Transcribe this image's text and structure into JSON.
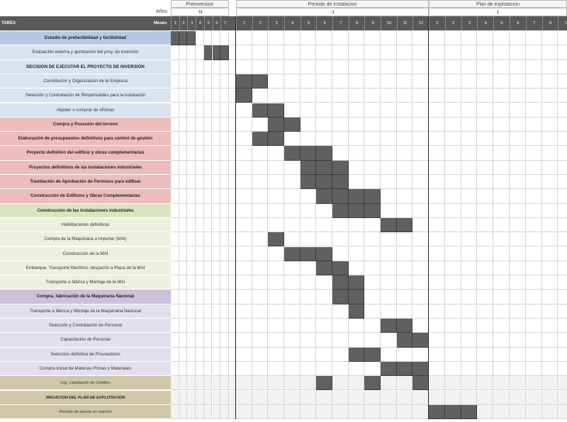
{
  "header": {
    "years_label": "Años",
    "months_label": "Meses",
    "task_label": "TAREA",
    "phases": [
      {
        "title": "Preinversion",
        "year": "-N"
      },
      {
        "title": "Periodo de instalacion",
        "year": "-1"
      },
      {
        "title": "Plan de explotacion",
        "year": "1"
      }
    ],
    "months": {
      "preinversion": [
        "1",
        "2",
        "3",
        "4",
        "5",
        "6",
        "7"
      ],
      "instalacion": [
        "1",
        "2",
        "3",
        "4",
        "5",
        "6",
        "7",
        "8",
        "9",
        "10",
        "11",
        "12"
      ],
      "explotacion": [
        "1",
        "2",
        "3",
        "4",
        "5",
        "6",
        "7",
        "8",
        "9"
      ]
    }
  },
  "colors": {
    "blue": "#dae3f0",
    "blue_strong": "#b5c9e4",
    "red": "#edbcbc",
    "red_strong": "#e6aaaa",
    "green": "#ebf1de",
    "green_strong": "#d8e6c0",
    "purple": "#e4dfec",
    "purple_strong": "#ccc0da",
    "olive": "#cfc7a6",
    "bar": "#606060"
  },
  "tasks": [
    {
      "label": "Estudio de prefactibilidad y factibilidad",
      "style": "bold",
      "color": "blue_strong",
      "bars": [
        [
          "pre",
          1,
          3
        ]
      ]
    },
    {
      "label": "Evaluación externa y aprobación del proy. de inversión",
      "style": "normal",
      "color": "blue",
      "bars": [
        [
          "pre",
          5,
          7
        ]
      ]
    },
    {
      "label": "DECISIÓN DE EJECUTAR EL PROYECTO DE INVERSIÓN",
      "style": "bold",
      "color": "blue",
      "bars": []
    },
    {
      "label": "Constitución y Organización de la Empresa",
      "style": "normal",
      "color": "blue",
      "bars": [
        [
          "ins",
          1,
          2
        ]
      ]
    },
    {
      "label": "Selección y Contratación de Responsables para la instalación",
      "style": "normal",
      "color": "blue",
      "bars": [
        [
          "ins",
          1,
          1
        ]
      ]
    },
    {
      "label": "Alquiler o comprar de oficinas",
      "style": "normal",
      "color": "blue",
      "bars": [
        [
          "ins",
          2,
          3
        ]
      ]
    },
    {
      "label": "Compra y Posesión del terreno",
      "style": "bold",
      "color": "red",
      "bars": [
        [
          "ins",
          3,
          4
        ]
      ]
    },
    {
      "label": "Elaboración de presupuestos definitivos para control de gestión",
      "style": "bold",
      "color": "red",
      "bars": [
        [
          "ins",
          2,
          3
        ]
      ]
    },
    {
      "label": "Proyecto definitivo del edificio y obras complementarias",
      "style": "bold",
      "color": "red",
      "bars": [
        [
          "ins",
          4,
          6
        ]
      ]
    },
    {
      "label": "Proyectos definitivos de las instalaciones industriales",
      "style": "bold",
      "color": "red",
      "bars": [
        [
          "ins",
          5,
          7
        ]
      ]
    },
    {
      "label": "Tramitación de Aprobación de Permisos para edificar",
      "style": "bold",
      "color": "red",
      "bars": [
        [
          "ins",
          5,
          7
        ]
      ]
    },
    {
      "label": "Construcción de Edificios y Obras Complementarias",
      "style": "bold",
      "color": "red",
      "bars": [
        [
          "ins",
          6,
          9
        ]
      ]
    },
    {
      "label": "Construcción de las instalaciones industriales",
      "style": "bold",
      "color": "green_strong",
      "bars": [
        [
          "ins",
          7,
          9
        ]
      ]
    },
    {
      "label": "Habilitaciones definitivas",
      "style": "normal",
      "color": "green",
      "bars": [
        [
          "ins",
          10,
          11
        ]
      ]
    },
    {
      "label": "Compra de la Maquinaria a Importar (MAI)",
      "style": "normal",
      "color": "green",
      "bars": [
        [
          "ins",
          3,
          3
        ]
      ]
    },
    {
      "label": "Construcción de la MAI",
      "style": "normal",
      "color": "green",
      "bars": [
        [
          "ins",
          4,
          6
        ]
      ]
    },
    {
      "label": "Embarque, Transporte Marítimo, despacho a Plaza de la MAI",
      "style": "normal",
      "color": "green",
      "bars": [
        [
          "ins",
          6,
          7
        ]
      ]
    },
    {
      "label": "Transporte a fábrica y Montaje de la MAI",
      "style": "normal",
      "color": "green",
      "bars": [
        [
          "ins",
          7,
          8
        ]
      ]
    },
    {
      "label": "Compra, fabricación de la Maquinaria Nacional",
      "style": "bold",
      "color": "purple_strong",
      "bars": [
        [
          "ins",
          7,
          8
        ]
      ]
    },
    {
      "label": "Transporte a fábrica y Montaje de la Maquinaria Nacional",
      "style": "normal",
      "color": "purple",
      "bars": [
        [
          "ins",
          8,
          8
        ]
      ]
    },
    {
      "label": "Selección y Contratación de Personal",
      "style": "normal",
      "color": "purple",
      "bars": [
        [
          "ins",
          10,
          11
        ]
      ]
    },
    {
      "label": "Capacitación de Personal",
      "style": "normal",
      "color": "purple",
      "bars": [
        [
          "ins",
          11,
          12
        ]
      ]
    },
    {
      "label": "Selección definitiva de Proveedores",
      "style": "normal",
      "color": "purple",
      "bars": [
        [
          "ins",
          8,
          9
        ]
      ]
    },
    {
      "label": "Compra Inicial de Materias Primas y Materiales",
      "style": "normal",
      "color": "purple",
      "bars": [
        [
          "ins",
          10,
          12
        ]
      ]
    },
    {
      "label": "Org. Liquidación de Créditos",
      "style": "italic",
      "color": "olive",
      "bars": [
        [
          "ins",
          6,
          6
        ],
        [
          "ins",
          9,
          9
        ],
        [
          "ins",
          12,
          12
        ]
      ]
    },
    {
      "label": "INICIACION DEL PLAN DE EXPLOTACION",
      "style": "italic-bold",
      "color": "olive",
      "bars": []
    },
    {
      "label": "Período de puesta en marcha",
      "style": "italic",
      "color": "olive",
      "bars": [
        [
          "exp",
          1,
          3
        ]
      ]
    }
  ]
}
